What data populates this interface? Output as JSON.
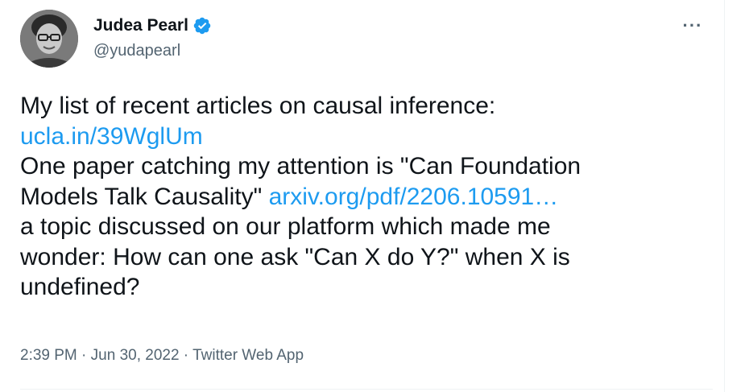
{
  "author": {
    "display_name": "Judea Pearl",
    "handle": "@yudapearl",
    "verified": true,
    "avatar_icon": "profile-photo"
  },
  "more_icon": "more-horizontal-icon",
  "more_glyph": "···",
  "tweet": {
    "line1": "My list of recent articles on causal inference:",
    "link1": "ucla.in/39WglUm",
    "line3": "One paper catching my attention is \"Can Foundation",
    "line4_text": "Models Talk Causality\" ",
    "link2": "arxiv.org/pdf/2206.10591…",
    "line5": "a topic discussed on our platform which made me",
    "line6": "wonder: How can one ask \"Can X do Y?\" when X is",
    "line7": "undefined?"
  },
  "meta": {
    "time": "2:39 PM",
    "separator": " · ",
    "date": "Jun 30, 2022",
    "source": "Twitter Web App"
  },
  "colors": {
    "link": "#1d9bf0",
    "secondary_text": "#536471",
    "primary_text": "#0f1419",
    "verified_badge": "#1d9bf0"
  }
}
